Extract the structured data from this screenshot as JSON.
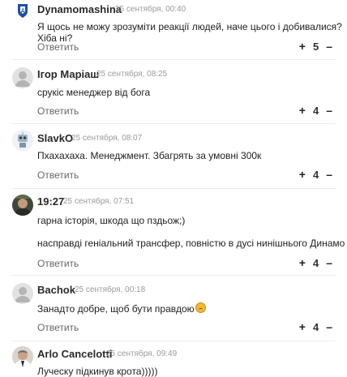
{
  "comments": [
    {
      "author": "Dynamomashina",
      "date": "25 сентября, 00:40",
      "lines": [
        "Я щось не можу зрозуміти реакції людей, наче цього і добивалися? Хіба ні?"
      ],
      "reply": "Ответить",
      "plus": "+",
      "score": "5",
      "minus": "–",
      "avatar": "dynamo-logo-avatar"
    },
    {
      "author": "Ігор Маріаш",
      "date": "25 сентября, 08:25",
      "lines": [
        "срукіс менеджер від бога"
      ],
      "reply": "Ответить",
      "plus": "+",
      "score": "4",
      "minus": "–",
      "avatar": "default-user-avatar"
    },
    {
      "author": "SlavkO",
      "date": "25 сентября, 08:07",
      "lines": [
        "Пхахахаха. Менеджмент. Збагрять за умовні 300к"
      ],
      "reply": "Ответить",
      "plus": "+",
      "score": "4",
      "minus": "–",
      "avatar": "robot-avatar"
    },
    {
      "author": "19:27",
      "date": "25 сентября, 07:51",
      "lines": [
        "гарна історія, шкода що пздьож;)",
        "насправді геніальний трансфер, повністю в дусі нинішнього Динамо"
      ],
      "reply": "Ответить",
      "plus": "+",
      "score": "4",
      "minus": "–",
      "avatar": "photo-avatar"
    },
    {
      "author": "Bachok",
      "date": "25 сентября, 00:18",
      "lines": [
        "Занадто добре, щоб бути правдою"
      ],
      "reply": "Ответить",
      "plus": "+",
      "score": "4",
      "minus": "–",
      "avatar": "default-user-avatar"
    },
    {
      "author": "Arlo Cancelotti",
      "date": "25 сентября, 09:49",
      "lines": [
        "Луческу підкинув крота)))))"
      ],
      "avatar": "portrait-avatar"
    }
  ],
  "colors": {
    "author": "#2a2a2a",
    "date": "#9a9a9a",
    "reply": "#666666",
    "separator": "#ececec"
  }
}
